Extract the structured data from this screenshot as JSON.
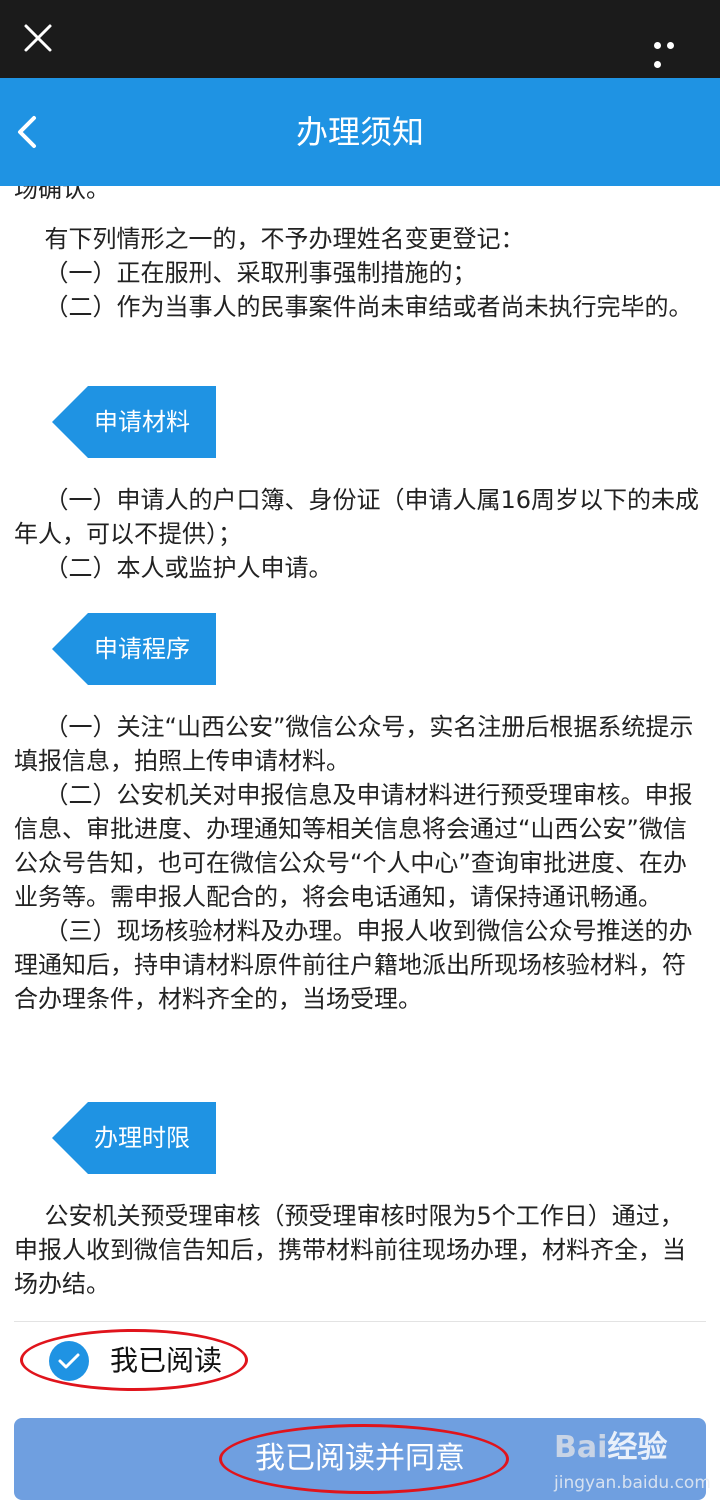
{
  "header": {
    "title": "办理须知"
  },
  "content": {
    "clipped_line": "场确认。",
    "p1": "    有下列情形之一的，不予办理姓名变更登记：\n    （一）正在服刑、采取刑事强制措施的；\n    （二）作为当事人的民事案件尚未审结或者尚未执行完毕的。",
    "section1": {
      "title": "申请材料"
    },
    "p2": "    （一）申请人的户口簿、身份证（申请人属16周岁以下的未成年人，可以不提供）；\n    （二）本人或监护人申请。",
    "section2": {
      "title": "申请程序"
    },
    "p3": "    （一）关注“山西公安”微信公众号，实名注册后根据系统提示填报信息，拍照上传申请材料。\n    （二）公安机关对申报信息及申请材料进行预受理审核。申报信息、审批进度、办理通知等相关信息将会通过“山西公安”微信公众号告知，也可在微信公众号“个人中心”查询审批进度、在办业务等。需申报人配合的，将会电话通知，请保持通讯畅通。\n    （三）现场核验材料及办理。申报人收到微信公众号推送的办理通知后，持申请材料原件前往户籍地派出所现场核验材料，符合办理条件，材料齐全的，当场受理。",
    "section3": {
      "title": "办理时限"
    },
    "p4": "    公安机关预受理审核（预受理审核时限为5个工作日）通过，申报人收到微信告知后，携带材料前往现场办理，材料齐全，当场办结。"
  },
  "footer": {
    "read_checkbox_label": "我已阅读",
    "read_checked": true,
    "agree_button": "我已阅读并同意"
  },
  "watermark": {
    "brand_a": "Bai",
    "brand_b": "经验",
    "url": "jingyan.baidu.com"
  },
  "colors": {
    "nav": "#1f93e3",
    "button": "#6f9fe0",
    "annotation": "#e0141c",
    "topbar": "#1b1b1b"
  },
  "icons": {
    "close": "close-icon",
    "more": "more-icon",
    "back": "back-chevron-icon",
    "check": "check-circle-icon"
  }
}
